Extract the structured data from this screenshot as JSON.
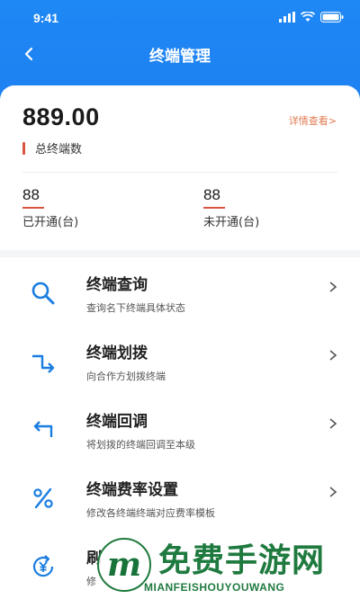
{
  "status_bar": {
    "time": "9:41"
  },
  "nav": {
    "title": "终端管理",
    "back_icon": "chevron-left-icon"
  },
  "summary": {
    "total_value": "889.00",
    "total_label": "总终端数",
    "detail_link": "详情查看>",
    "stats": [
      {
        "value": "88",
        "label": "已开通(台)"
      },
      {
        "value": "88",
        "label": "未开通(台)"
      }
    ]
  },
  "menu": {
    "items": [
      {
        "title": "终端查询",
        "desc": "查询名下终端具体状态",
        "icon": "search-icon"
      },
      {
        "title": "终端划拨",
        "desc": "向合作方划拨终端",
        "icon": "transfer-icon"
      },
      {
        "title": "终端回调",
        "desc": "将划拨的终端回调至本级",
        "icon": "return-icon"
      },
      {
        "title": "终端费率设置",
        "desc": "修改各终端终端对应费率模板",
        "icon": "percent-icon"
      },
      {
        "title": "刷",
        "desc": "修",
        "icon": "yuan-refresh-icon"
      }
    ]
  },
  "watermark": {
    "logo_letter": "m",
    "text": "免费手游网",
    "sub": "MIANFEISHOUYOUWANG"
  },
  "colors": {
    "header_blue": "#1e88f5",
    "accent_red": "#d9533f",
    "link_orange": "#e07b52",
    "icon_blue": "#1a7de0"
  }
}
